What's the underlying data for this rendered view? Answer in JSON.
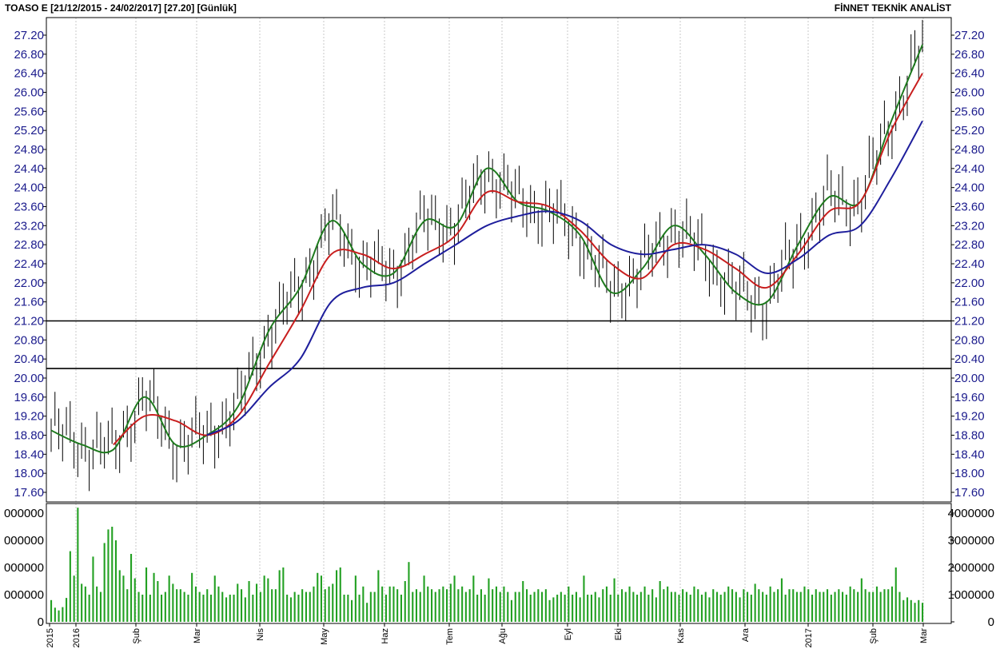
{
  "header": {
    "title": "TOASO E  [21/12/2015 - 24/02/2017]  [27.20]  [Günlük]",
    "brand": "FİNNET TEKNİK ANALİST"
  },
  "chart_data": [
    {
      "type": "line",
      "title": "TOASO E  [21/12/2015 - 24/02/2017]  [27.20]  [Günlük]",
      "ylim": [
        17.4,
        27.4
      ],
      "y_ticks": [
        "27.20",
        "26.80",
        "26.40",
        "26.00",
        "25.60",
        "25.20",
        "24.80",
        "24.40",
        "24.00",
        "23.60",
        "23.20",
        "22.80",
        "22.40",
        "22.00",
        "21.60",
        "21.20",
        "20.80",
        "20.40",
        "20.00",
        "19.60",
        "19.20",
        "18.80",
        "18.40",
        "18.00",
        "17.60"
      ],
      "x_ticks": [
        "2015",
        "2016",
        "Şub",
        "Mar",
        "Nis",
        "May",
        "Haz",
        "Tem",
        "Ağu",
        "Eyl",
        "Eki",
        "Kas",
        "Ara",
        "2017",
        "Şub",
        "Mar"
      ],
      "grid": true,
      "horizontal_lines": [
        21.2,
        20.2
      ],
      "x": [
        "2015-12",
        "2016-01a",
        "2016-01b",
        "2016-02a",
        "2016-02b",
        "2016-03a",
        "2016-03b",
        "2016-04a",
        "2016-04b",
        "2016-05a",
        "2016-05b",
        "2016-06a",
        "2016-06b",
        "2016-07a",
        "2016-07b",
        "2016-08a",
        "2016-08b",
        "2016-09a",
        "2016-09b",
        "2016-10a",
        "2016-10b",
        "2016-11a",
        "2016-11b",
        "2016-12a",
        "2016-12b",
        "2017-01a",
        "2017-01b",
        "2017-02a",
        "2017-02b"
      ],
      "series": [
        {
          "values": [
            18.9,
            18.6,
            18.5,
            19.6,
            18.6,
            18.8,
            19.4,
            21.0,
            21.9,
            23.3,
            22.4,
            22.2,
            23.3,
            23.2,
            24.4,
            23.7,
            23.5,
            23.0,
            21.8,
            22.3,
            23.2,
            22.6,
            21.8,
            21.6,
            22.8,
            23.8,
            23.7,
            25.4,
            27.0
          ],
          "color": "#1e7a1e"
        },
        {
          "values": [
            null,
            null,
            18.6,
            19.2,
            19.1,
            18.8,
            19.2,
            20.3,
            21.4,
            22.6,
            22.6,
            22.3,
            22.6,
            23.0,
            23.9,
            23.7,
            23.6,
            23.1,
            22.4,
            22.1,
            22.8,
            22.7,
            22.3,
            21.9,
            22.6,
            23.5,
            23.7,
            25.2,
            26.4
          ],
          "color": "#c81e1e"
        },
        {
          "values": [
            null,
            null,
            null,
            null,
            null,
            18.8,
            19.1,
            19.8,
            20.4,
            21.6,
            21.9,
            22.0,
            22.4,
            22.8,
            23.2,
            23.4,
            23.5,
            23.3,
            22.8,
            22.6,
            22.7,
            22.8,
            22.6,
            22.2,
            22.5,
            23.0,
            23.2,
            24.2,
            25.4
          ],
          "color": "#1e1e9c"
        }
      ]
    },
    {
      "type": "bar",
      "y_ticks": [
        "4000000",
        "3000000",
        "2000000",
        "1000000",
        "0"
      ],
      "ylim": [
        0,
        4200000
      ],
      "color": "#22a022",
      "values": [
        800000,
        520000,
        420000,
        540000,
        880000,
        2600000,
        1700000,
        4200000,
        1400000,
        1300000,
        1000000,
        2400000,
        1300000,
        1100000,
        2900000,
        3400000,
        3500000,
        3000000,
        1900000,
        1700000,
        1200000,
        2500000,
        1600000,
        1100000,
        1000000,
        2000000,
        1000000,
        1800000,
        1500000,
        1000000,
        1100000,
        1700000,
        1400000,
        1200000,
        1200000,
        1100000,
        1000000,
        1800000,
        1300000,
        1100000,
        1000000,
        1200000,
        1000000,
        1700000,
        1300000,
        1100000,
        900000,
        1000000,
        1000000,
        1400000,
        1200000,
        900000,
        1500000,
        1000000,
        1400000,
        1100000,
        1700000,
        1600000,
        1200000,
        1200000,
        1900000,
        2000000,
        1000000,
        900000,
        1100000,
        1000000,
        1200000,
        1100000,
        1100000,
        1300000,
        1800000,
        1700000,
        1200000,
        1300000,
        1400000,
        1900000,
        2000000,
        1000000,
        1000000,
        800000,
        1700000,
        1000000,
        1300000,
        700000,
        1100000,
        1100000,
        1900000,
        1300000,
        1000000,
        1300000,
        1300000,
        1200000,
        1000000,
        1500000,
        2200000,
        1100000,
        1200000,
        1100000,
        1700000,
        1300000,
        1200000,
        1100000,
        1200000,
        1300000,
        1200000,
        1400000,
        1700000,
        1200000,
        1300000,
        1100000,
        1200000,
        1700000,
        1000000,
        1200000,
        1000000,
        1600000,
        1200000,
        1300000,
        1100000,
        1300000,
        1100000,
        800000,
        1100000,
        1100000,
        1500000,
        1200000,
        1000000,
        1100000,
        1200000,
        1100000,
        1200000,
        800000,
        900000,
        1000000,
        1100000,
        1000000,
        1300000,
        1000000,
        1100000,
        900000,
        1700000,
        1000000,
        1000000,
        1100000,
        900000,
        1200000,
        1300000,
        1000000,
        1600000,
        1000000,
        1200000,
        1100000,
        1300000,
        1100000,
        1000000,
        1100000,
        1300000,
        1000000,
        1200000,
        900000,
        1500000,
        1200000,
        1300000,
        1100000,
        1100000,
        1000000,
        1200000,
        1100000,
        1000000,
        1300000,
        1200000,
        1000000,
        1100000,
        900000,
        1200000,
        1100000,
        1000000,
        1100000,
        1300000,
        1200000,
        1100000,
        900000,
        1200000,
        1100000,
        1000000,
        1400000,
        1200000,
        1100000,
        1000000,
        1300000,
        1100000,
        1200000,
        1600000,
        1000000,
        1200000,
        1200000,
        1100000,
        1100000,
        1300000,
        1200000,
        1000000,
        1200000,
        1100000,
        1100000,
        1200000,
        1000000,
        1100000,
        1200000,
        1100000,
        1000000,
        1300000,
        1200000,
        1100000,
        1600000,
        1200000,
        1100000,
        1100000,
        1300000,
        1100000,
        1200000,
        1200000,
        1300000,
        2000000,
        1100000,
        800000,
        900000,
        800000,
        700000,
        800000,
        700000
      ]
    }
  ]
}
